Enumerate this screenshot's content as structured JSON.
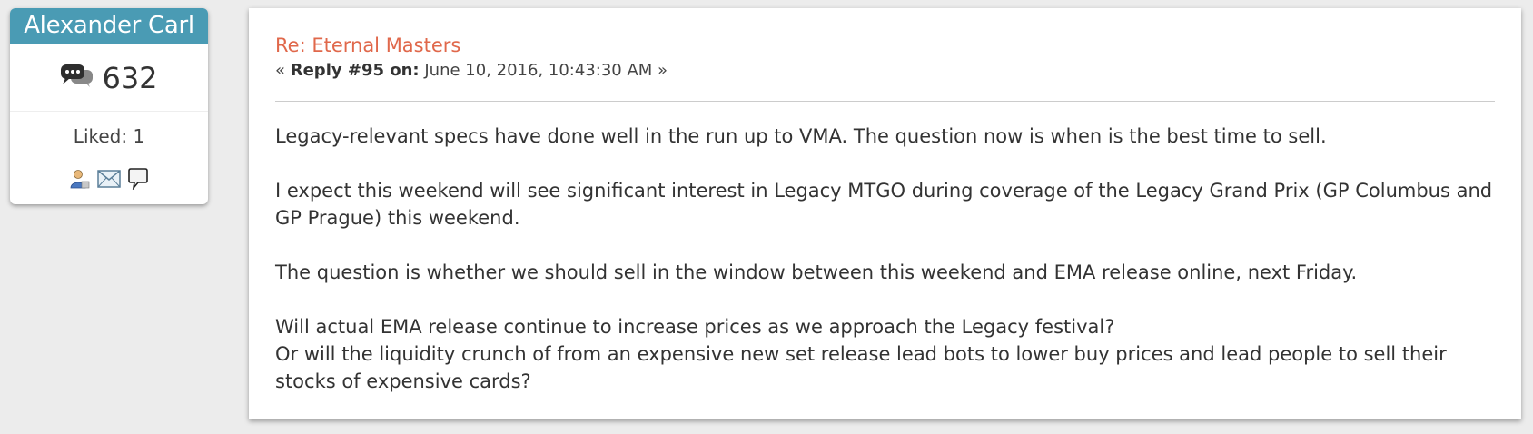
{
  "poster": {
    "name": "Alexander Carl",
    "post_count": "632",
    "liked": "Liked: 1",
    "icons": [
      "posts-icon",
      "profile-icon",
      "email-icon",
      "message-icon"
    ]
  },
  "post": {
    "subject": "Re: Eternal Masters",
    "meta_prefix": "« ",
    "reply_label": "Reply #95 on:",
    "date": " June 10, 2016, 10:43:30 AM »",
    "paragraphs": [
      "Legacy-relevant specs have done well in the run up to VMA. The question now is when is the best time to sell.",
      "I expect this weekend will see significant interest in Legacy MTGO during coverage of the Legacy Grand Prix (GP Columbus and GP Prague) this weekend.",
      "The question is whether we should sell in the window between this weekend and EMA release online, next Friday.",
      "Will actual EMA release continue to increase prices as we approach the Legacy festival?",
      "Or will the liquidity crunch of from an expensive new set release lead bots to lower buy prices and lead people to sell their stocks of expensive cards?"
    ]
  },
  "colors": {
    "name_bar": "#4a9bb4",
    "subject": "#e0684b",
    "background": "#ececec"
  }
}
